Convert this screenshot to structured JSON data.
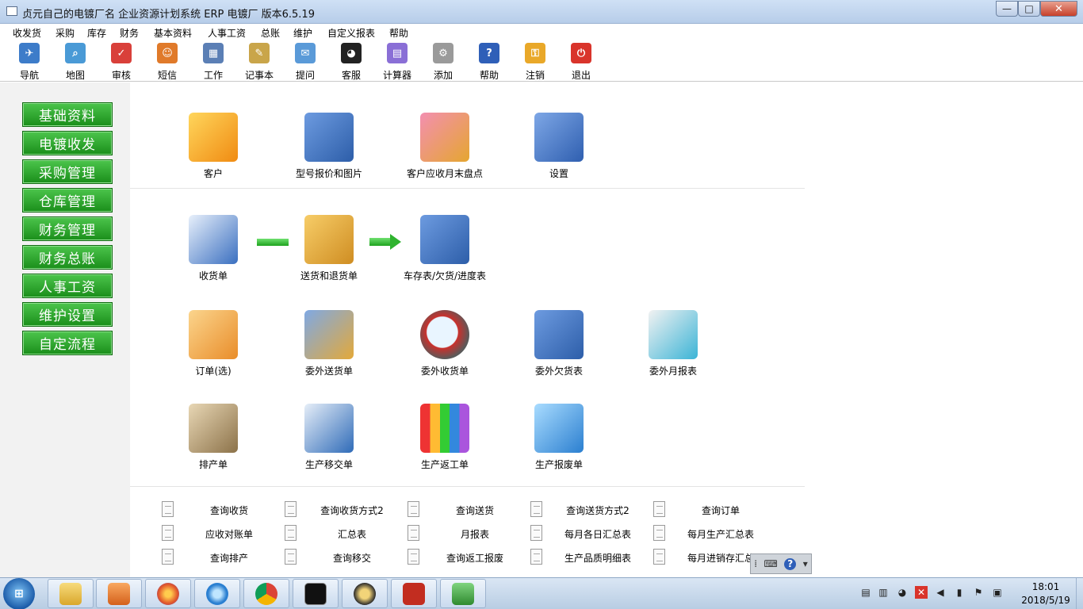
{
  "window": {
    "title": "贞元自己的电镀厂名 企业资源计划系统 ERP 电镀厂 版本6.5.19",
    "min_glyph": "—",
    "max_glyph": "□",
    "close_glyph": "✕"
  },
  "menu": [
    "收发货",
    "采购",
    "库存",
    "财务",
    "基本资料",
    "人事工资",
    "总账",
    "维护",
    "自定义报表",
    "帮助"
  ],
  "toolbar": [
    {
      "label": "导航",
      "icon": "navigation-icon",
      "color": "#3d7cc9",
      "glyph": "✈"
    },
    {
      "label": "地图",
      "icon": "magnifier-icon",
      "color": "#4a9ad6",
      "glyph": "⌕"
    },
    {
      "label": "审核",
      "icon": "calendar-check-icon",
      "color": "#d9403a",
      "glyph": "✓"
    },
    {
      "label": "短信",
      "icon": "users-icon",
      "color": "#e07a2a",
      "glyph": "☺"
    },
    {
      "label": "工作",
      "icon": "calendar-icon",
      "color": "#5b7fb5",
      "glyph": "▦"
    },
    {
      "label": "记事本",
      "icon": "notepad-icon",
      "color": "#c9a54a",
      "glyph": "✎"
    },
    {
      "label": "提问",
      "icon": "mail-icon",
      "color": "#5a9ad8",
      "glyph": "✉"
    },
    {
      "label": "客服",
      "icon": "qq-penguin-icon",
      "color": "#222222",
      "glyph": "◕"
    },
    {
      "label": "计算器",
      "icon": "calculator-icon",
      "color": "#8a6fd6",
      "glyph": "▤"
    },
    {
      "label": "添加",
      "icon": "gear-icon",
      "color": "#9a9a9a",
      "glyph": "⚙"
    },
    {
      "label": "帮助",
      "icon": "help-icon",
      "color": "#2f5fb8",
      "glyph": "?"
    },
    {
      "label": "注销",
      "icon": "key-icon",
      "color": "#e9a829",
      "glyph": "⚿"
    },
    {
      "label": "退出",
      "icon": "power-icon",
      "color": "#d9342b",
      "glyph": "⏻"
    }
  ],
  "sidebar": [
    "基础资料",
    "电镀收发",
    "采购管理",
    "仓库管理",
    "财务管理",
    "财务总账",
    "人事工资",
    "维护设置",
    "自定流程"
  ],
  "row1": [
    {
      "label": "客户",
      "icon": "buildings-icon",
      "color": "#f3a11d"
    },
    {
      "label": "型号报价和图片",
      "icon": "book-house-icon",
      "color": "#3f6eb3"
    },
    {
      "label": "客户应收月末盘点",
      "icon": "house-money-icon",
      "color": "#e2466a"
    },
    {
      "label": "设置",
      "icon": "tools-icon",
      "color": "#4a78c2"
    }
  ],
  "flow": [
    {
      "label": "收货单",
      "icon": "form-pen-icon",
      "color": "#3a6fc0"
    },
    {
      "label": "送货和退货单",
      "icon": "package-icon",
      "color": "#e3a93a"
    },
    {
      "label": "车存表/欠货/进度表",
      "icon": "book-house-icon",
      "color": "#3f6eb3"
    }
  ],
  "row3": [
    {
      "label": "订单(选)",
      "icon": "clipboard-pencil-icon",
      "color": "#e98d2a"
    },
    {
      "label": "委外送货单",
      "icon": "folder-box-icon",
      "color": "#3a78c9"
    },
    {
      "label": "委外收货单",
      "icon": "magnifier-arrow-icon",
      "color": "#c9302c"
    },
    {
      "label": "委外欠货表",
      "icon": "book-house-icon",
      "color": "#3f6eb3"
    },
    {
      "label": "委外月报表",
      "icon": "document-cubes-icon",
      "color": "#3bb4d6"
    }
  ],
  "row4": [
    {
      "label": "排产单",
      "icon": "calendar-schedule-icon",
      "color": "#b79a6b"
    },
    {
      "label": "生产移交单",
      "icon": "transfer-icon",
      "color": "#2f6bb8"
    },
    {
      "label": "生产返工单",
      "icon": "bar-blocks-icon",
      "color": "#3d7fd4"
    },
    {
      "label": "生产报废单",
      "icon": "folder-home-icon",
      "color": "#4fa7e6"
    }
  ],
  "queries": [
    [
      "查询收货",
      "查询收货方式2",
      "查询送货",
      "查询送货方式2",
      "查询订单"
    ],
    [
      "应收对账单",
      "汇总表",
      "月报表",
      "每月各日汇总表",
      "每月生产汇总表"
    ],
    [
      "查询排产",
      "查询移交",
      "查询返工报废",
      "生产品质明细表",
      "每月进销存汇总"
    ]
  ],
  "ime": {
    "keyboard": "⌨",
    "help": "?"
  },
  "taskbar": {
    "apps": [
      {
        "icon": "file-explorer-icon",
        "color": "#e9c45a"
      },
      {
        "icon": "media-player-icon",
        "color": "#e77a22"
      },
      {
        "icon": "firefox-icon",
        "color": "#e2572b"
      },
      {
        "icon": "internet-explorer-icon",
        "color": "#2a7fd1"
      },
      {
        "icon": "chrome-icon",
        "color": "#3aa859"
      },
      {
        "icon": "command-prompt-icon",
        "color": "#111111"
      },
      {
        "icon": "ultraedit-icon",
        "color": "#c9a23a"
      },
      {
        "icon": "filezilla-icon",
        "color": "#c22d20"
      },
      {
        "icon": "excel-icon",
        "color": "#3b8a3b"
      }
    ],
    "time": "18:01",
    "date": "2018/5/19"
  }
}
